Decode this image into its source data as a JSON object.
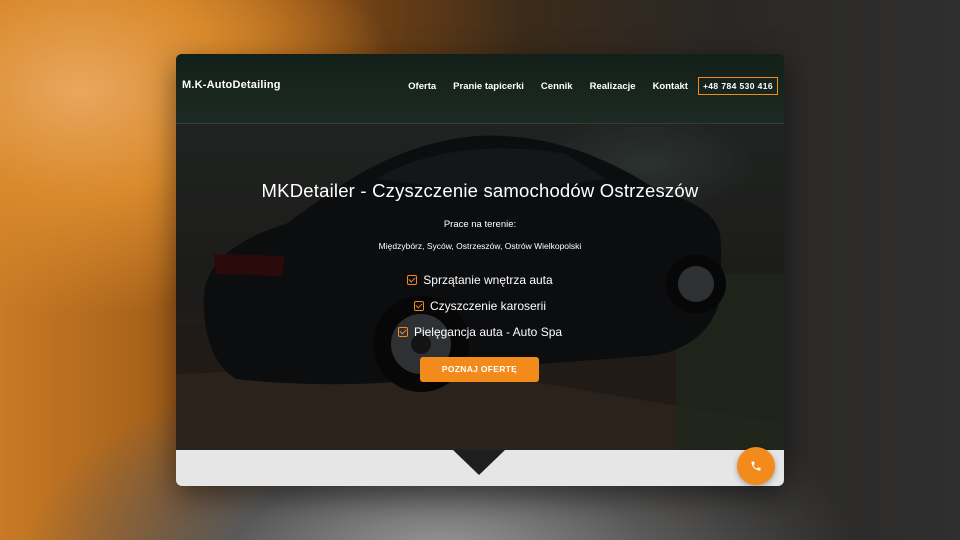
{
  "brand": "M.K-AutoDetailing",
  "nav": {
    "items": [
      "Oferta",
      "Pranie tapicerki",
      "Cennik",
      "Realizacje",
      "Kontakt"
    ],
    "phone": "+48 784 530 416"
  },
  "hero": {
    "title": "MKDetailer - Czyszczenie samochodów Ostrzeszów",
    "area_label": "Prace na terenie:",
    "area_list": "Międzybórz, Syców, Ostrzeszów, Ostrów Wielkopolski",
    "features": [
      "Sprzątanie wnętrza auta",
      "Czyszczenie karoserii",
      "Pielęgancja auta - Auto Spa"
    ],
    "cta_label": "POZNAJ OFERTĘ"
  },
  "icons": {
    "feature_icon": "checkbox-icon",
    "fab_icon": "phone-icon"
  },
  "colors": {
    "accent": "#f28a1c",
    "navbar": "#13201a",
    "band": "#e6e6e6"
  }
}
